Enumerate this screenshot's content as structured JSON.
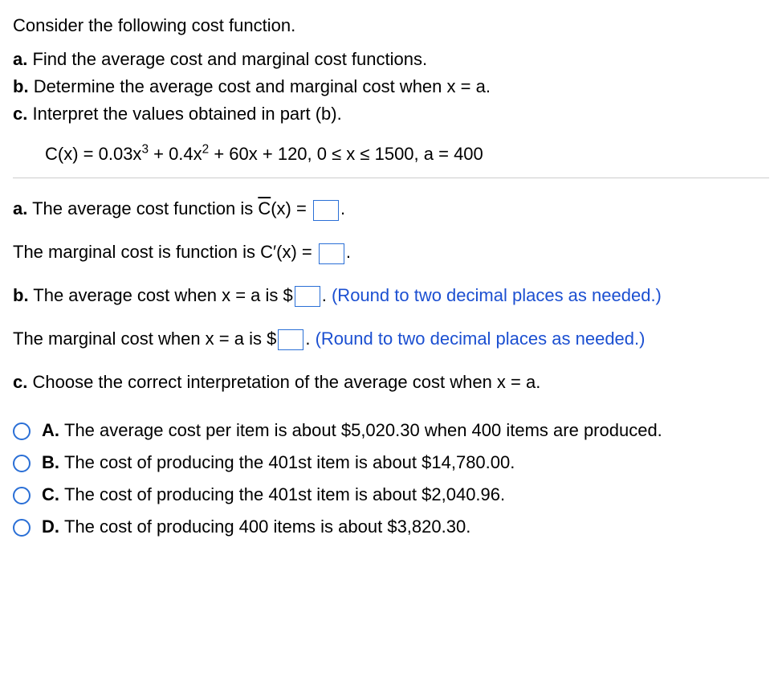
{
  "intro": "Consider the following cost function.",
  "parts": {
    "a": "Find the average cost and marginal cost functions.",
    "b": "Determine the average cost and marginal cost when x = a.",
    "c": "Interpret the values obtained in part (b)."
  },
  "formula": {
    "lhs": "C(x) = 0.03x",
    "exp1": "3",
    "mid1": " + 0.4x",
    "exp2": "2",
    "rest": " + 60x + 120, 0 ≤ x ≤ 1500, a = 400"
  },
  "answers": {
    "a_avg_pre": "The average cost function is ",
    "a_avg_func": "C",
    "a_avg_post": "(x) = ",
    "a_marg": "The marginal cost is function is C′(x) = ",
    "b_avg_pre": "The average cost when x = a is $",
    "b_avg_hint": "(Round to two decimal places as needed.)",
    "b_marg_pre": "The marginal cost when x = a is $",
    "b_marg_hint": "(Round to two decimal places as needed.)",
    "c_prompt": "Choose the correct interpretation of the average cost when x = a."
  },
  "choices": [
    {
      "letter": "A.",
      "text": "The average cost per item is about $5,020.30 when 400 items are produced."
    },
    {
      "letter": "B.",
      "text": "The cost of producing the 401st item is about $14,780.00."
    },
    {
      "letter": "C.",
      "text": "The cost of producing the 401st item is about $2,040.96."
    },
    {
      "letter": "D.",
      "text": "The cost of producing 400 items is about $3,820.30."
    }
  ],
  "labels": {
    "a": "a.",
    "b": "b.",
    "c": "c."
  }
}
